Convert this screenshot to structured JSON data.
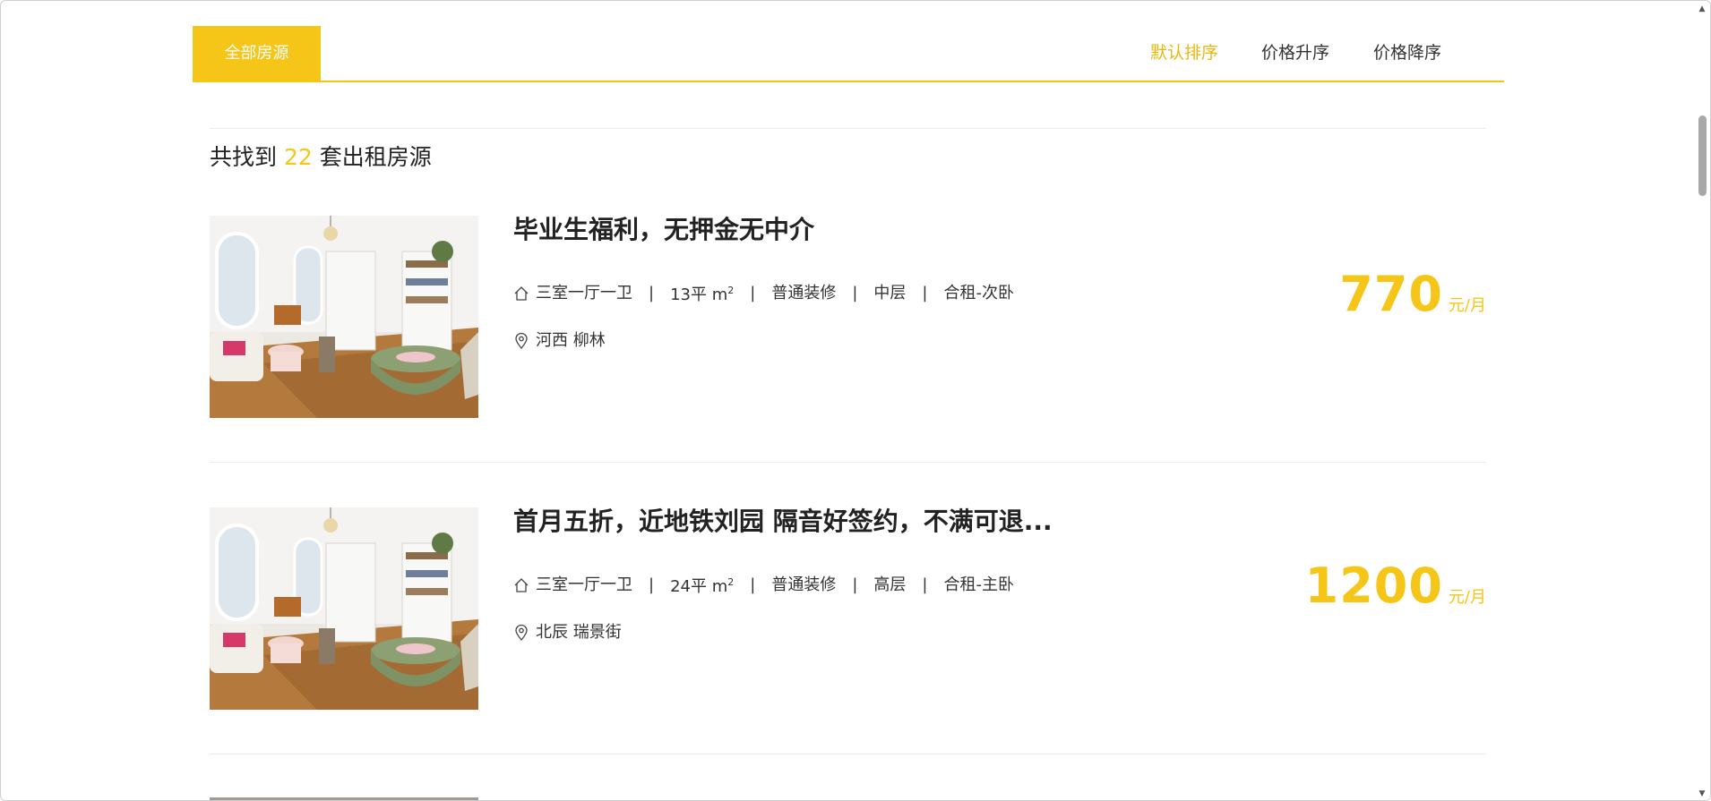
{
  "tabs": {
    "all_label": "全部房源",
    "sort_default": "默认排序",
    "sort_asc": "价格升序",
    "sort_desc": "价格降序"
  },
  "results": {
    "prefix": "共找到",
    "count": "22",
    "suffix": "套出租房源"
  },
  "colors": {
    "accent": "#f5c518",
    "active_sort": "#e8b80f",
    "text": "#333333"
  },
  "listings": [
    {
      "title": "毕业生福利，无押金无中介",
      "layout": "三室一厅一卫",
      "area": "13平 m",
      "area_sup": "2",
      "decoration": "普通装修",
      "floor": "中层",
      "rent_type": "合租-次卧",
      "location": "河西 柳林",
      "price": "770",
      "unit": "元/月"
    },
    {
      "title": "首月五折，近地铁刘园 隔音好签约，不满可退...",
      "layout": "三室一厅一卫",
      "area": "24平 m",
      "area_sup": "2",
      "decoration": "普通装修",
      "floor": "高层",
      "rent_type": "合租-主卧",
      "location": "北辰 瑞景街",
      "price": "1200",
      "unit": "元/月"
    }
  ],
  "icons": {
    "house": "house-icon",
    "location": "location-pin-icon"
  }
}
